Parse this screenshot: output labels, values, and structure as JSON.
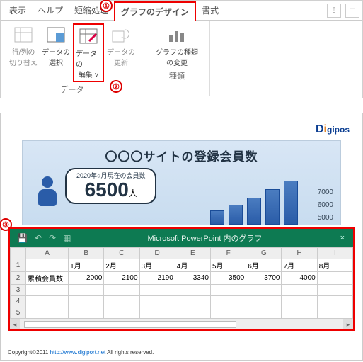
{
  "markers": {
    "m1": "①",
    "m2": "②",
    "m3": "③"
  },
  "tabs": {
    "t1": "表示",
    "t2": "ヘルプ",
    "t3": "短縮処理",
    "t4": "グラフのデザイン",
    "t5": "書式"
  },
  "qat": {
    "share": "⇪",
    "comment": "□"
  },
  "ribbon": {
    "g1": {
      "b1": {
        "l1": "行/列の",
        "l2": "切り替え"
      },
      "b2": {
        "l1": "データの",
        "l2": "選択"
      },
      "b3": {
        "l1": "データの",
        "l2": "編集 ˅"
      },
      "b4": {
        "l1": "データの",
        "l2": "更新"
      },
      "label": "データ"
    },
    "g2": {
      "b1": {
        "l1": "グラフの種類",
        "l2": "の変更"
      },
      "label": "種類"
    }
  },
  "logo": {
    "d": "D",
    "i": "i",
    "rest": "gipos"
  },
  "chart": {
    "title": "〇〇〇サイトの登録会員数",
    "callout": {
      "small": "2020年○月現在の会員数",
      "big": "6500",
      "unit": "人"
    },
    "ylabels": {
      "a": "7000",
      "b": "6000",
      "c": "5000"
    }
  },
  "excel": {
    "title": "Microsoft PowerPoint 内のグラフ",
    "close": "×",
    "cols": [
      "",
      "A",
      "B",
      "C",
      "D",
      "E",
      "F",
      "G",
      "H",
      "I"
    ],
    "rows": {
      "1": [
        "1",
        "",
        "1月",
        "2月",
        "3月",
        "4月",
        "5月",
        "6月",
        "7月",
        "8月"
      ],
      "2": [
        "2",
        "累積会員数",
        "2000",
        "2100",
        "2190",
        "3340",
        "3500",
        "3700",
        "4000",
        ""
      ],
      "3": [
        "3",
        "",
        "",
        "",
        "",
        "",
        "",
        "",
        "",
        ""
      ],
      "4": [
        "4",
        "",
        "",
        "",
        "",
        "",
        "",
        "",
        "",
        ""
      ],
      "5": [
        "5",
        "",
        "",
        "",
        "",
        "",
        "",
        "",
        "",
        ""
      ]
    }
  },
  "copyright": {
    "pre": "Copyright©2011 ",
    "link": "http://www.digiport.net",
    "post": " All rights reserved."
  },
  "chart_data": {
    "type": "bar",
    "title": "〇〇〇サイトの登録会員数",
    "categories": [
      "1月",
      "2月",
      "3月",
      "4月",
      "5月",
      "6月",
      "7月",
      "8月"
    ],
    "series": [
      {
        "name": "累積会員数",
        "values": [
          2000,
          2100,
          2190,
          3340,
          3500,
          3700,
          4000,
          null
        ]
      }
    ],
    "ylim": [
      0,
      7000
    ],
    "callout_value": 6500
  }
}
